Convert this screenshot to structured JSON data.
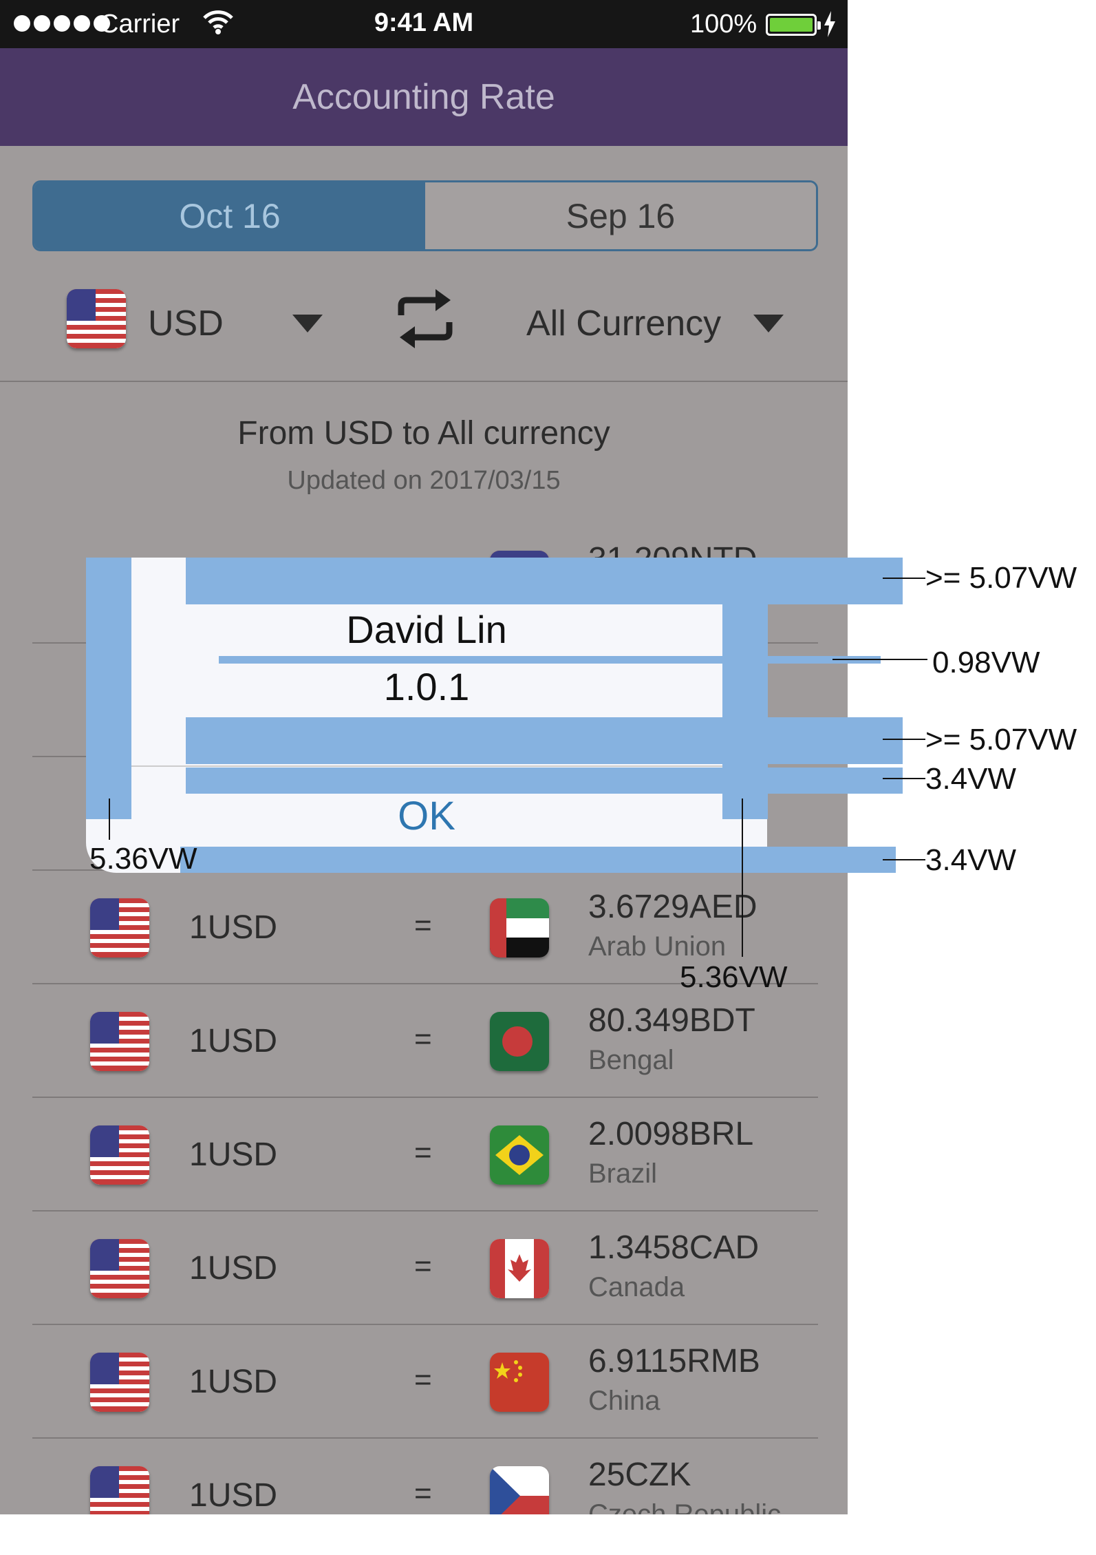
{
  "status_bar": {
    "carrier": "Carrier",
    "time": "9:41 AM",
    "battery": "100%"
  },
  "nav": {
    "title": "Accounting Rate"
  },
  "tabs": [
    {
      "label": "Oct 16",
      "selected": true
    },
    {
      "label": "Sep 16",
      "selected": false
    }
  ],
  "selector": {
    "from_currency": "USD",
    "to_currency": "All Currency"
  },
  "heading": "From USD to All currency",
  "updated": "Updated on 2017/03/15",
  "partial_row_value": "31.209NTD",
  "rows": [
    {
      "left": "1USD",
      "eq": "=",
      "value": "3.6729AED",
      "name": "Arab Union",
      "flag": "uae"
    },
    {
      "left": "1USD",
      "eq": "=",
      "value": "80.349BDT",
      "name": "Bengal",
      "flag": "bangladesh"
    },
    {
      "left": "1USD",
      "eq": "=",
      "value": "2.0098BRL",
      "name": "Brazil",
      "flag": "brazil"
    },
    {
      "left": "1USD",
      "eq": "=",
      "value": "1.3458CAD",
      "name": "Canada",
      "flag": "canada"
    },
    {
      "left": "1USD",
      "eq": "=",
      "value": "6.9115RMB",
      "name": "China",
      "flag": "china"
    },
    {
      "left": "1USD",
      "eq": "=",
      "value": "25CZK",
      "name": "Czech Republic",
      "flag": "czech"
    }
  ],
  "dialog": {
    "name": "David Lin",
    "version": "1.0.1",
    "ok": "OK"
  },
  "annotations": {
    "top": ">= 5.07VW",
    "line_gap": "0.98VW",
    "bottom_pad": ">= 5.07VW",
    "button_pad_top": "3.4VW",
    "button_pad_bottom": "3.4VW",
    "left_margin": "5.36VW",
    "right_margin": "5.36VW"
  },
  "colors": {
    "nav": "#4b3866",
    "segment": "#3f6c90",
    "overlay": "#86b2e0",
    "ok": "#2e76b0"
  }
}
